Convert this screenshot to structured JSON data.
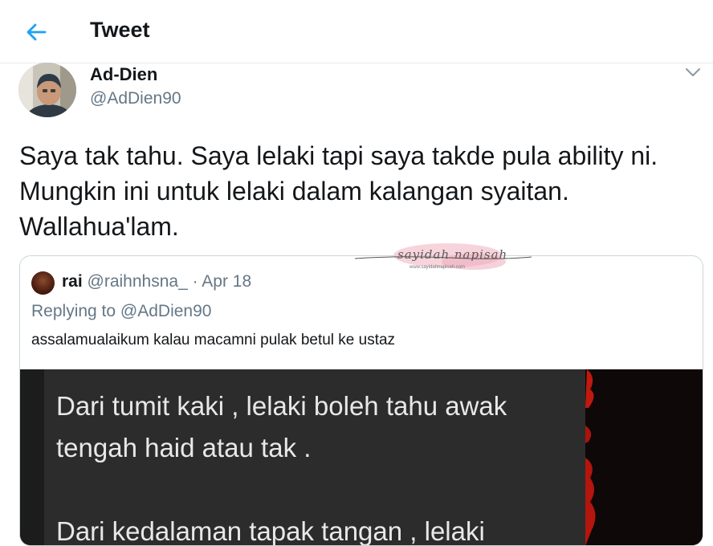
{
  "header": {
    "title": "Tweet",
    "back_icon": "back-arrow-icon",
    "accent_color": "#1da1f2"
  },
  "tweet": {
    "author_name": "Ad-Dien",
    "author_handle": "@AdDien90",
    "text": "Saya tak tahu. Saya lelaki tapi saya takde pula ability ni.\nMungkin ini untuk  lelaki dalam kalangan syaitan.\nWallahua'lam.",
    "menu_icon": "chevron-down-icon"
  },
  "quoted_tweet": {
    "author_name": "rai",
    "author_handle": "@raihnhsna_",
    "separator": "·",
    "date": "Apr 18",
    "replying_label": "Replying to",
    "replying_to": "@AdDien90",
    "text": "assalamualaikum kalau macamni pulak betul ke ustaz",
    "image_text": "Dari tumit kaki , lelaki boleh tahu awak\ntengah haid atau tak .\n\nDari kedalaman tapak tangan , lelaki"
  },
  "watermark": {
    "text": "sayidah napisah",
    "url": "www.sayidahnapisah.com"
  }
}
